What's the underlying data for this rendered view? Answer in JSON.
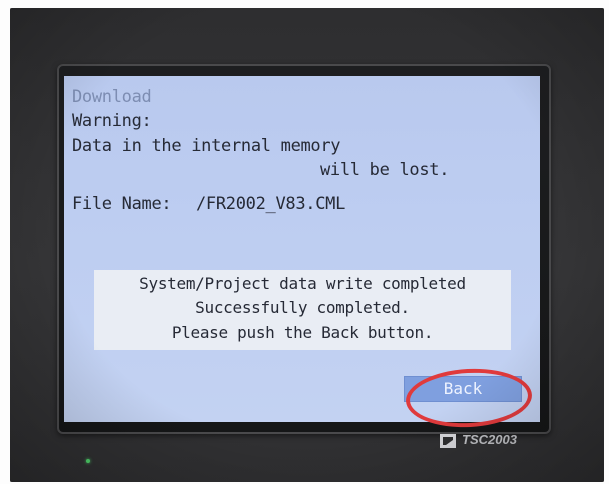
{
  "screen": {
    "title": "Download",
    "warning": "Warning:",
    "data_line": "Data in the internal memory",
    "lost_line": "will be lost.",
    "file_label": "File Name:",
    "file_value": "/FR2002_V83.CML"
  },
  "status": {
    "line1": "System/Project data write completed",
    "line2": "Successfully completed.",
    "line3": "Please push the Back button."
  },
  "back_button": {
    "label": "Back"
  },
  "device": {
    "model": "TSC2003"
  },
  "colors": {
    "screen_bg": "#bdcdf1",
    "button_bg": "#7f9fdf",
    "annotation": "#e03a3c",
    "led": "#4fd46b"
  }
}
